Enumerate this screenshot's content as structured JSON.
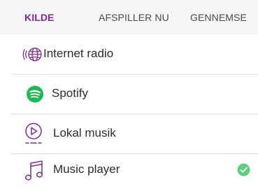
{
  "tabs": [
    {
      "label": "KILDE"
    },
    {
      "label": "AFSPILLER NU"
    },
    {
      "label": "GENNEMSE"
    }
  ],
  "sources": [
    {
      "label": "Internet radio",
      "icon": "internet-radio-icon"
    },
    {
      "label": "Spotify",
      "icon": "spotify-icon"
    },
    {
      "label": "Lokal musik",
      "icon": "local-music-icon"
    },
    {
      "label": "Music player",
      "icon": "music-note-icon",
      "selected": true
    }
  ],
  "colors": {
    "accent": "#7b2d8e",
    "spotify": "#1db954",
    "check": "#5fcf7e",
    "tab_background": "#f5f5f7"
  }
}
